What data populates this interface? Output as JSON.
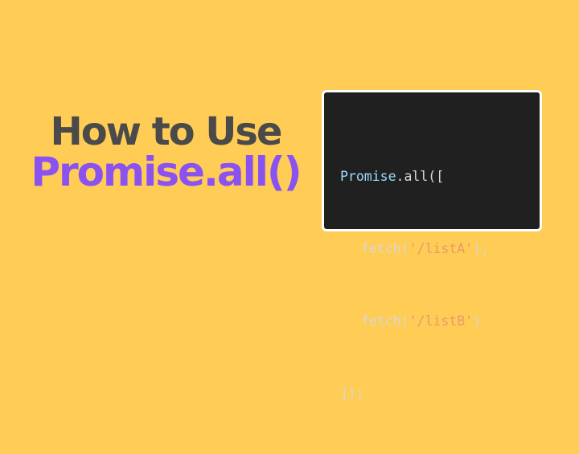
{
  "title": {
    "line1": "How to Use",
    "line2": "Promise.all()"
  },
  "code": {
    "line1": {
      "object": "Promise",
      "dot": ".",
      "method": "all",
      "open": "(["
    },
    "line2": {
      "fn": "fetch",
      "open": "(",
      "arg": "'/listA'",
      "close": "),"
    },
    "line3": {
      "fn": "fetch",
      "open": "(",
      "arg": "'/listB'",
      "close": ")"
    },
    "line4": {
      "close": "]);"
    }
  },
  "colors": {
    "background": "#FFCC55",
    "title_primary": "#4a4a4a",
    "title_accent": "#8B52F2",
    "code_background": "#202020",
    "code_identifier": "#9CDCFE",
    "code_string": "#E89A6E"
  }
}
